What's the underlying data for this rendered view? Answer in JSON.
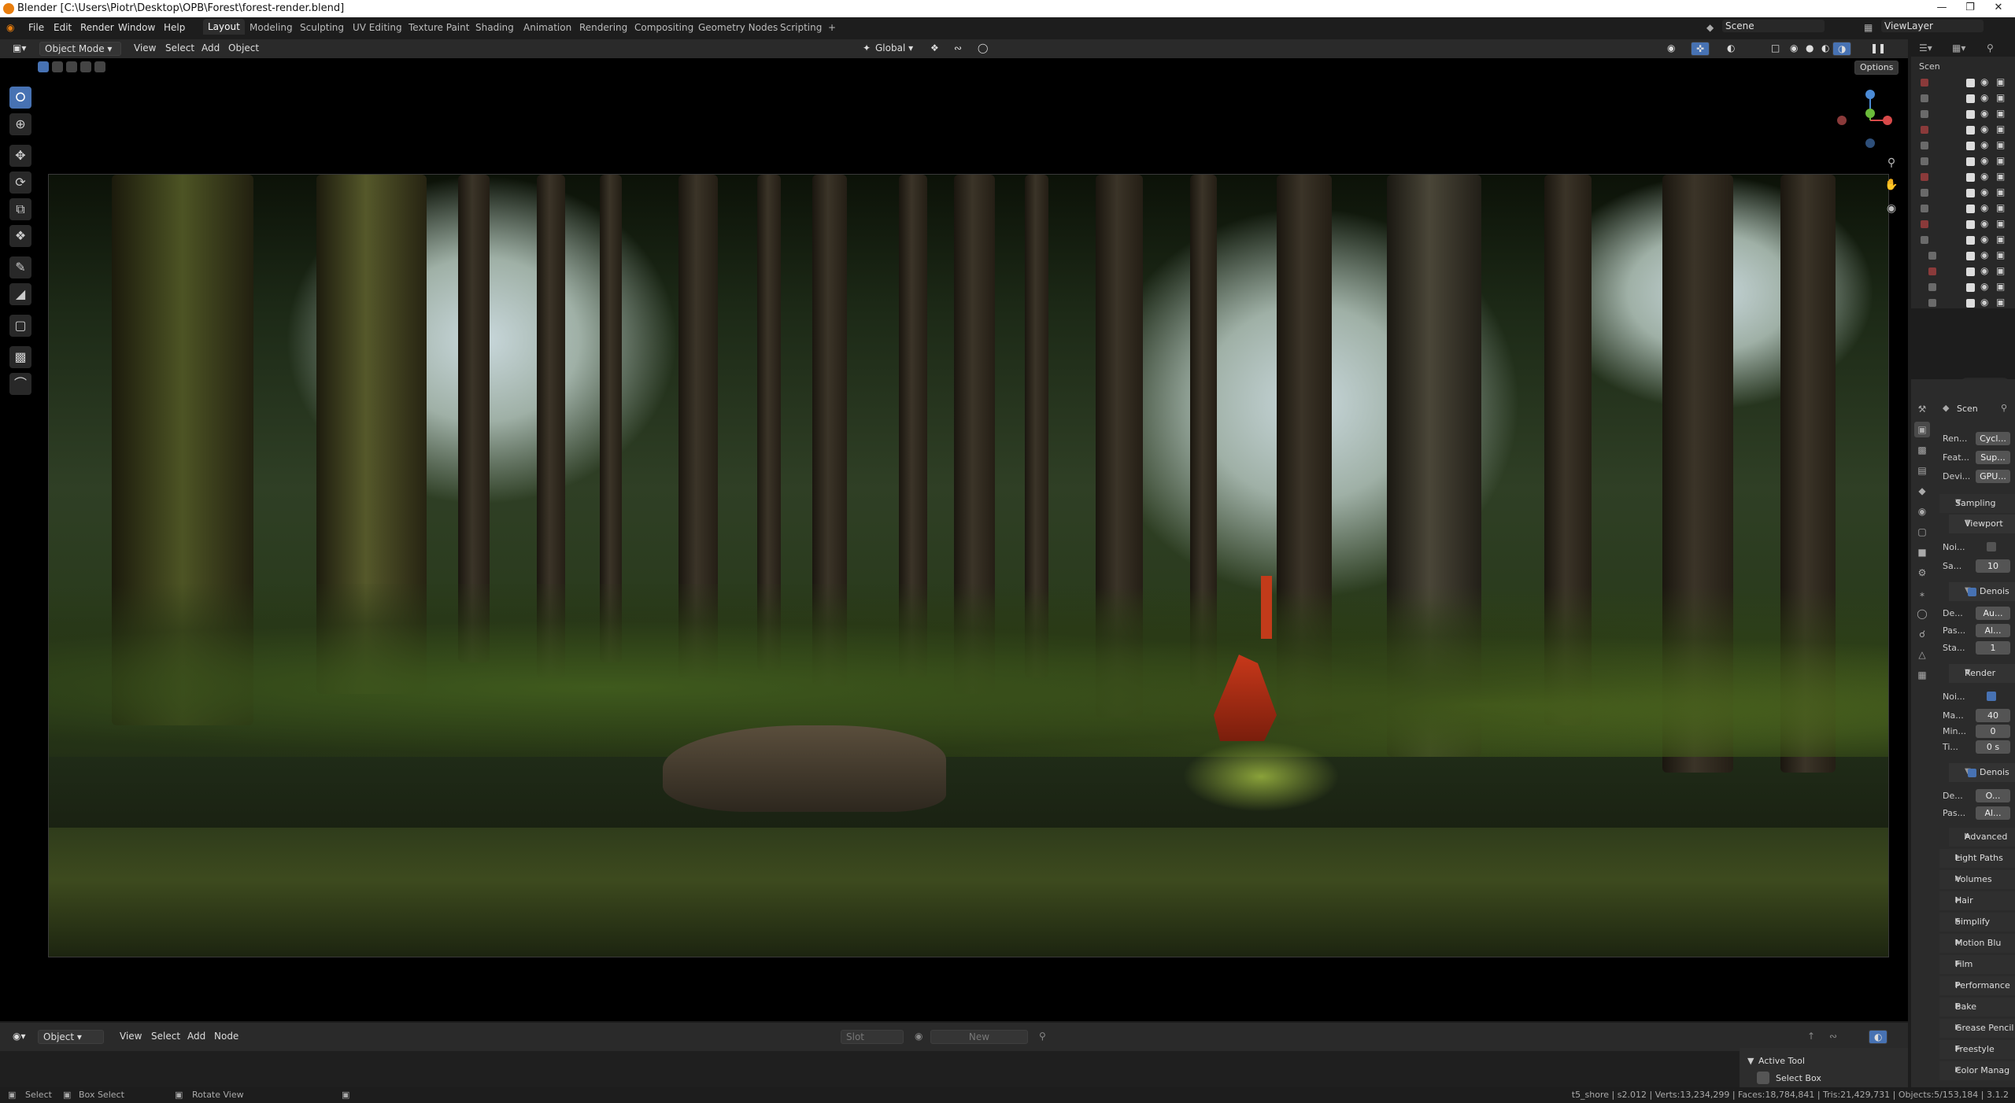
{
  "window": {
    "title": "Blender [C:\\Users\\Piotr\\Desktop\\OPB\\Forest\\forest-render.blend]"
  },
  "menubar": {
    "items": [
      "File",
      "Edit",
      "Render",
      "Window",
      "Help"
    ]
  },
  "workspaces": {
    "tabs": [
      "Layout",
      "Modeling",
      "Sculpting",
      "UV Editing",
      "Texture Paint",
      "Shading",
      "Animation",
      "Rendering",
      "Compositing",
      "Geometry Nodes",
      "Scripting"
    ],
    "active": "Layout",
    "add": "+"
  },
  "scene": {
    "name": "Scene",
    "view_layer": "ViewLayer"
  },
  "header3d": {
    "mode": "Object Mode",
    "menus": [
      "View",
      "Select",
      "Add",
      "Object"
    ],
    "orientation": "Global",
    "options": "Options"
  },
  "outliner": {
    "header": "Scen"
  },
  "properties": {
    "header": "Scen",
    "rows_top": [
      {
        "label": "Ren...",
        "value": "Cycl..."
      },
      {
        "label": "Feat...",
        "value": "Sup..."
      },
      {
        "label": "Devi...",
        "value": "GPU..."
      }
    ],
    "sampling": "Sampling",
    "viewport": "Viewport",
    "vp_noise": "Noi...",
    "vp_samples": {
      "label": "Sa...",
      "value": "10"
    },
    "denoise1": "Denois",
    "vp_rows": [
      {
        "label": "De...",
        "value": "Au..."
      },
      {
        "label": "Pas...",
        "value": "Al..."
      },
      {
        "label": "Sta...",
        "value": "1"
      }
    ],
    "render": "Render",
    "r_noise": "Noi...",
    "r_rows": [
      {
        "label": "Ma...",
        "value": "40"
      },
      {
        "label": "Min...",
        "value": "0"
      },
      {
        "label": "Ti...",
        "value": "0 s"
      }
    ],
    "denoise2": "Denois",
    "r_rows2": [
      {
        "label": "De...",
        "value": "O..."
      },
      {
        "label": "Pas...",
        "value": "Al..."
      }
    ],
    "panels": [
      "Advanced",
      "Light Paths",
      "Volumes",
      "Hair",
      "Simplify",
      "Motion Blu",
      "Film",
      "Performance",
      "Bake",
      "Grease Pencil",
      "Freestyle",
      "Color Manag"
    ]
  },
  "bottom": {
    "editor": "Object",
    "menus": [
      "View",
      "Select",
      "Add",
      "Node"
    ],
    "slot": "Slot",
    "new": "New"
  },
  "active_tool": {
    "title": "Active Tool",
    "tool": "Select Box"
  },
  "status": {
    "select": "Select",
    "box_select": "Box Select",
    "rotate": "Rotate View",
    "stats": "t5_shore | s2.012 | Verts:13,234,299 | Faces:18,784,841 | Tris:21,429,731 | Objects:5/153,184 | 3.1.2"
  },
  "colors": {
    "accent": "#4772b3",
    "brand": "#e87d0d"
  }
}
